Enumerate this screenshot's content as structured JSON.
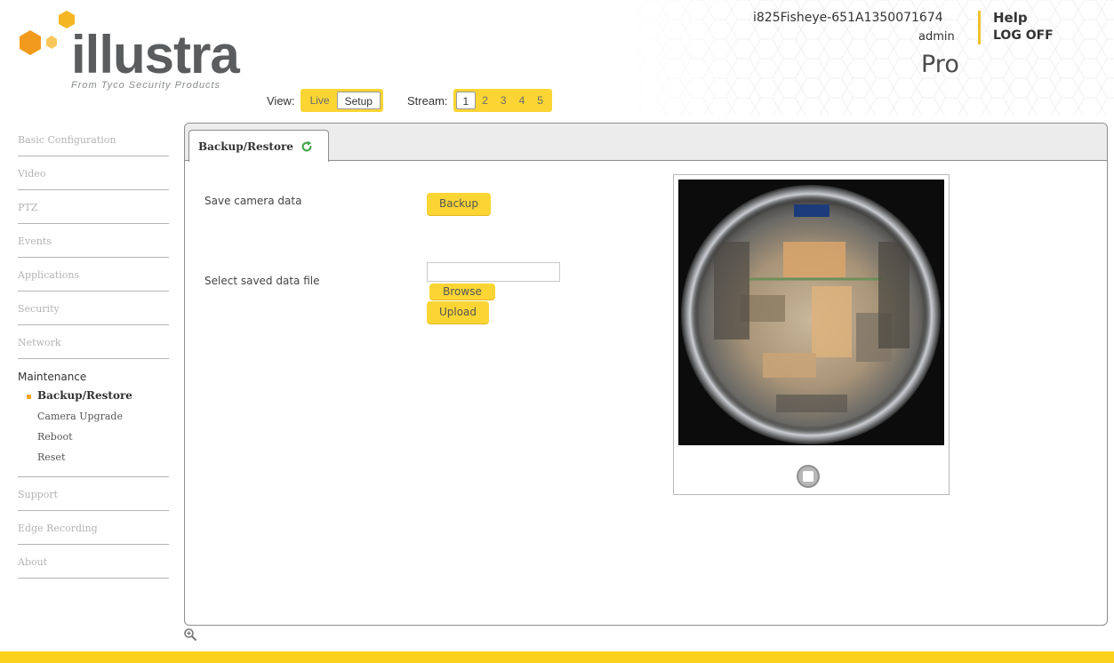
{
  "brand": {
    "name": "illustra",
    "tagline": "From Tyco Security Products",
    "accent_color": "#fbd534",
    "logo_orange": "#f29a1d"
  },
  "header": {
    "camera_name": "i825Fisheye-651A1350071674",
    "user": "admin",
    "help_label": "Help",
    "logoff_label": "LOG OFF",
    "edition": "Pro",
    "view": {
      "label": "View:",
      "options": [
        "Live",
        "Setup"
      ],
      "selected": "Setup"
    },
    "stream": {
      "label": "Stream:",
      "options": [
        "1",
        "2",
        "3",
        "4",
        "5"
      ],
      "selected": "1"
    }
  },
  "sidebar": {
    "items_before": [
      {
        "label": "Basic Configuration"
      },
      {
        "label": "Video"
      },
      {
        "label": "PTZ"
      },
      {
        "label": "Events"
      },
      {
        "label": "Applications"
      },
      {
        "label": "Security"
      },
      {
        "label": "Network"
      }
    ],
    "active_section": {
      "label": "Maintenance",
      "children": [
        {
          "label": "Backup/Restore",
          "active": true
        },
        {
          "label": "Camera Upgrade"
        },
        {
          "label": "Reboot"
        },
        {
          "label": "Reset"
        }
      ]
    },
    "items_after": [
      {
        "label": "Support"
      },
      {
        "label": "Edge Recording"
      },
      {
        "label": "About"
      }
    ]
  },
  "main": {
    "tab_label": "Backup/Restore",
    "save_label": "Save camera data",
    "backup_button": "Backup",
    "select_label": "Select saved data file",
    "file_value": "",
    "browse_button": "Browse",
    "upload_button": "Upload",
    "preview": {
      "icon": "fisheye-live-view",
      "control_icon": "stop-icon"
    }
  },
  "footer": {
    "zoom_icon": "zoom-in-icon"
  }
}
